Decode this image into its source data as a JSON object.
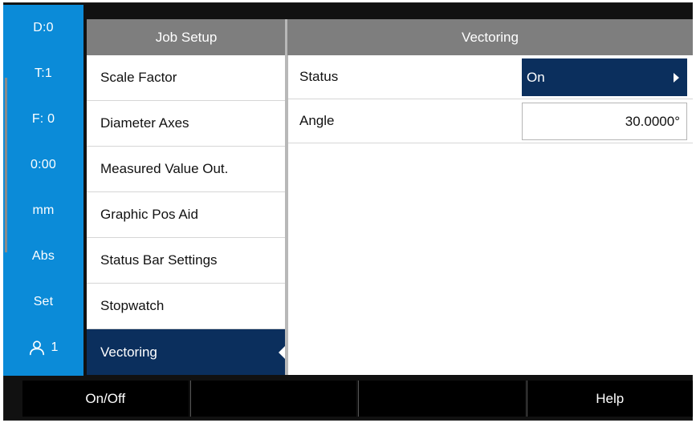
{
  "status_bar": {
    "items": [
      "D:0",
      "T:1",
      "F:  0",
      "0:00",
      "mm",
      "Abs",
      "Set"
    ],
    "user_number": "1",
    "user_icon": "user-icon"
  },
  "list_panel": {
    "title": "Job Setup",
    "items": [
      "Scale Factor",
      "Diameter Axes",
      "Measured Value Out.",
      "Graphic Pos Aid",
      "Status Bar Settings",
      "Stopwatch",
      "Vectoring"
    ],
    "selected_index": 6
  },
  "detail_panel": {
    "title": "Vectoring",
    "rows": [
      {
        "label": "Status",
        "value": "On",
        "type": "select"
      },
      {
        "label": "Angle",
        "value": "30.0000°",
        "type": "input"
      }
    ]
  },
  "softkeys": [
    "On/Off",
    "",
    "",
    "Help"
  ],
  "colors": {
    "status_bar_bg": "#0B8BD8",
    "header_bg": "#7E7E7E",
    "selected_bg": "#0B2F5D",
    "softkey_bg": "#000000"
  }
}
